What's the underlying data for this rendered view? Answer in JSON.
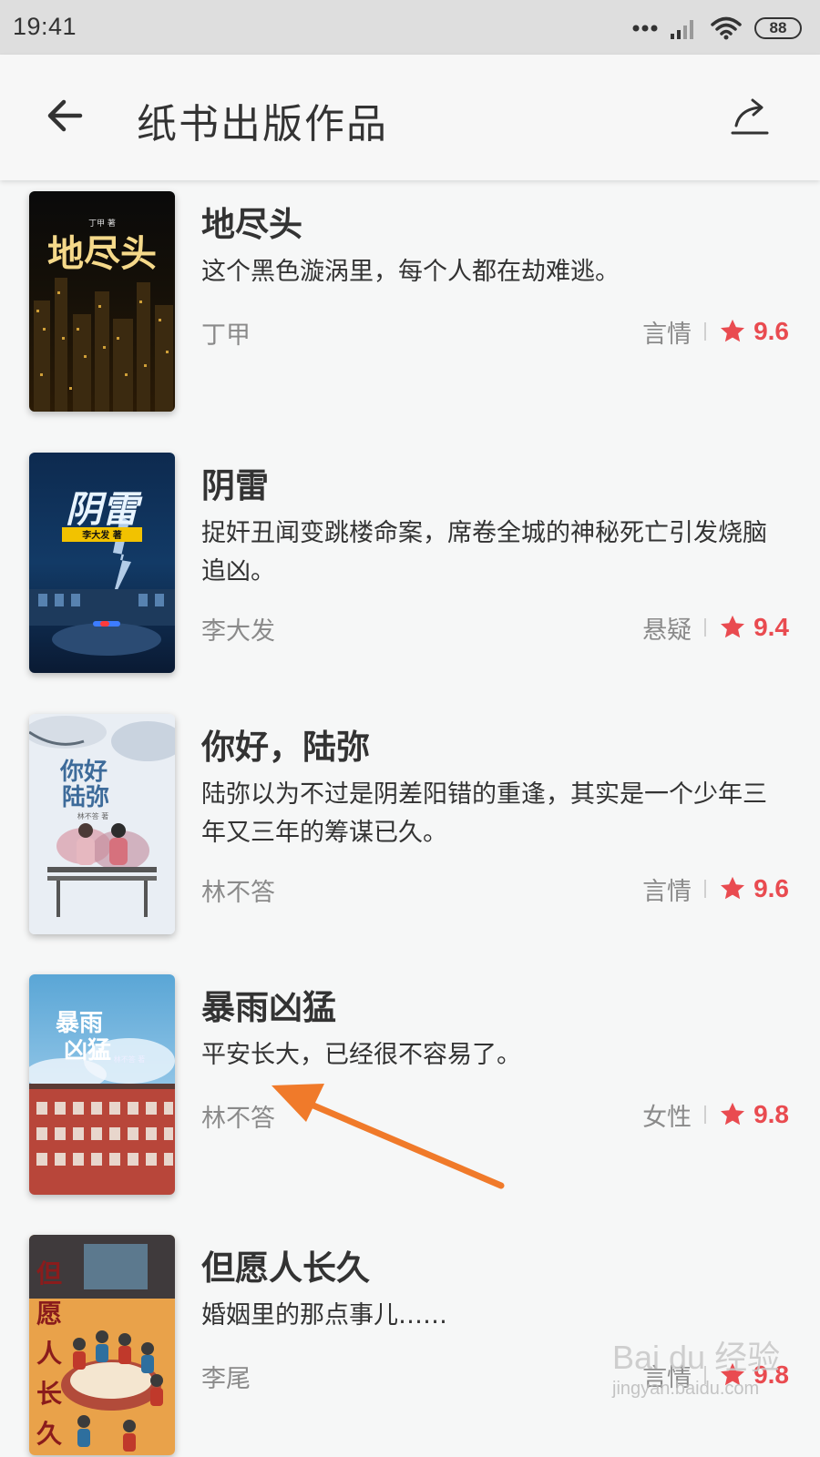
{
  "status_bar": {
    "time": "19:41",
    "battery": "88"
  },
  "header": {
    "title": "纸书出版作品"
  },
  "books": [
    {
      "title": "地尽头",
      "desc": "这个黑色漩涡里，每个人都在劫难逃。",
      "author": "丁甲",
      "genre": "言情",
      "rating": "9.6",
      "cover_text": "地尽头",
      "cover_author": "丁甲 著"
    },
    {
      "title": "阴雷",
      "desc": "捉奸丑闻变跳楼命案，席卷全城的神秘死亡引发烧脑追凶。",
      "author": "李大发",
      "genre": "悬疑",
      "rating": "9.4",
      "cover_text": "阴雷",
      "cover_author": "李大发 著"
    },
    {
      "title": "你好，陆弥",
      "desc": "陆弥以为不过是阴差阳错的重逢，其实是一个少年三年又三年的筹谋已久。",
      "author": "林不答",
      "genre": "言情",
      "rating": "9.6",
      "cover_text_1": "你好",
      "cover_text_2": "陆弥",
      "cover_author": "林不答 著"
    },
    {
      "title": "暴雨凶猛",
      "desc": "平安长大，已经很不容易了。",
      "author": "林不答",
      "genre": "女性",
      "rating": "9.8",
      "cover_text_1": "暴雨",
      "cover_text_2": "凶猛",
      "cover_author": "林不答 著"
    },
    {
      "title": "但愿人长久",
      "desc": "婚姻里的那点事儿……",
      "author": "李尾",
      "genre": "言情",
      "rating": "9.8",
      "cover_text": "但愿人长久"
    }
  ],
  "watermark": {
    "brand": "Bai du 经验",
    "url": "jingyan.baidu.com"
  },
  "colors": {
    "accent": "#e94b50",
    "annotation_arrow": "#f07a2a"
  }
}
